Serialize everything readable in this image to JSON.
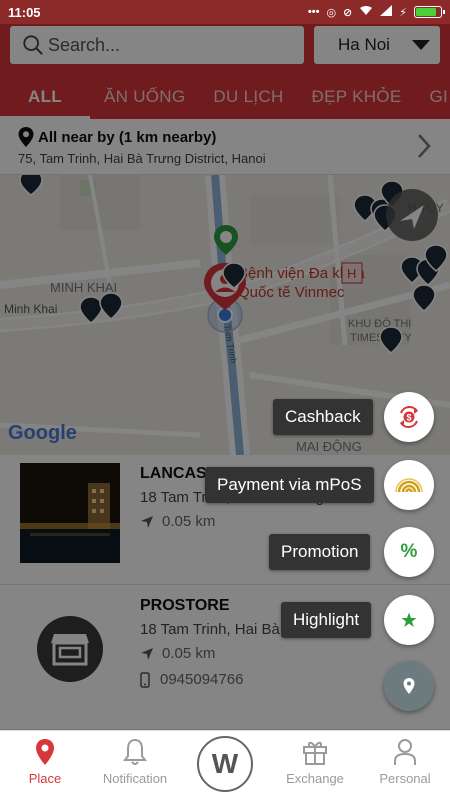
{
  "status_bar": {
    "time": "11:05",
    "icons": [
      "more-icon",
      "circle-icon",
      "alarm-off-icon",
      "wifi-icon",
      "signal-icon",
      "charging-icon",
      "battery-icon"
    ],
    "battery_level": 0.85
  },
  "search": {
    "placeholder": "Search...",
    "city": "Ha Noi"
  },
  "tabs": [
    {
      "label": "ALL",
      "active": true
    },
    {
      "label": "ĂN UỐNG"
    },
    {
      "label": "DU LỊCH"
    },
    {
      "label": "ĐẸP KHỎE"
    },
    {
      "label": "GI"
    }
  ],
  "location": {
    "title": "All near by (1 km nearby)",
    "address": "75, Tam Trinh, Hai Bà Trưng District, Hanoi"
  },
  "map": {
    "labels": {
      "hospital_1": "Bệnh viện Đa khoa",
      "hospital_2": "Quốc tế Vinmec",
      "minh_khai_upper": "MINH KHAI",
      "minh_khai_road": "Minh Khai",
      "khu_do_thi_1": "KHU ĐÔ THỊ",
      "khu_do_thi_2": "TIMES CITY",
      "mai_dong": "MAI ĐỘNG",
      "truy": "H TỤY",
      "h_marker": "H",
      "road_small": "Tam Trinh"
    },
    "google_logo": "Google"
  },
  "places": [
    {
      "name": "LANCASTER HANOI SERVIC",
      "address": "18 Tam Trinh, Hai Bà Trưng",
      "distance": "0.05 km"
    },
    {
      "name": "PROSTORE",
      "address": "18 Tam Trinh, Hai Bà Trưng",
      "distance": "0.05 km",
      "phone": "0945094766"
    }
  ],
  "fab_menu": [
    {
      "label": "Cashback",
      "icon": "cashback-icon",
      "color": "#d7373a"
    },
    {
      "label": "Payment via mPoS",
      "icon": "mpos-icon",
      "color": "#d4a017"
    },
    {
      "label": "Promotion",
      "icon": "percent-icon",
      "color": "#2e9e3e"
    },
    {
      "label": "Highlight",
      "icon": "star-icon",
      "color": "#2e9e3e"
    }
  ],
  "bottom_nav": {
    "place": "Place",
    "notification": "Notification",
    "center_logo": "W",
    "exchange": "Exchange",
    "personal": "Personal"
  },
  "colors": {
    "brand_red": "#d7373a",
    "overlay": "rgba(0,0,0,0.48)"
  }
}
